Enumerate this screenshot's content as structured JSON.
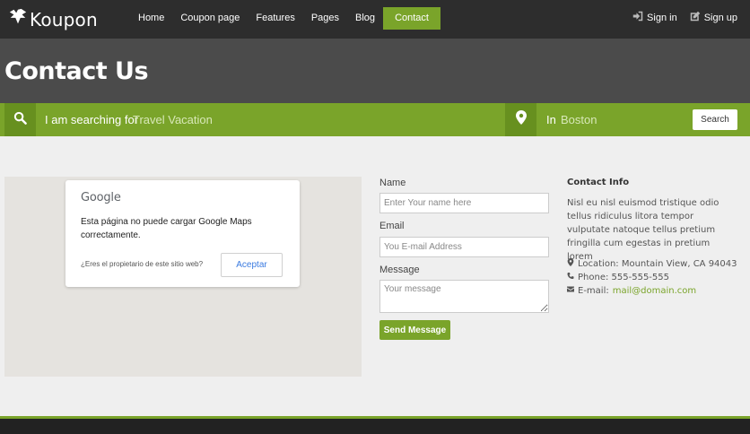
{
  "brand": {
    "name": "Koupon"
  },
  "nav": {
    "items": [
      {
        "label": "Home"
      },
      {
        "label": "Coupon page"
      },
      {
        "label": "Features"
      },
      {
        "label": "Pages"
      },
      {
        "label": "Blog"
      },
      {
        "label": "Contact",
        "active": true
      }
    ]
  },
  "auth": {
    "sign_in": "Sign in",
    "sign_up": "Sign up"
  },
  "page": {
    "title": "Contact Us"
  },
  "search": {
    "label": "I am searching for",
    "placeholder": "Travel Vacation",
    "location_label": "In",
    "location_placeholder": "Boston",
    "button": "Search"
  },
  "map": {
    "logo": "Google",
    "message": "Esta página no puede cargar Google Maps correctamente.",
    "owner_question": "¿Eres el propietario de este sitio web?",
    "accept": "Aceptar"
  },
  "form": {
    "name_label": "Name",
    "name_placeholder": "Enter Your name here",
    "email_label": "Email",
    "email_placeholder": "You E-mail Address",
    "message_label": "Message",
    "message_placeholder": "Your message",
    "submit": "Send Message"
  },
  "contact_info": {
    "title": "Contact Info",
    "text": "Nisl eu nisl euismod tristique odio tellus ridiculus litora tempor vulputate natoque tellus pretium fringilla cum egestas in pretium lorem",
    "location": "Location: Mountain View, CA 94043",
    "phone": "Phone: 555-555-555",
    "email_label": "E-mail:",
    "email": "mail@domain.com"
  },
  "colors": {
    "accent": "#7aa42a",
    "navbar": "#2d2d2d",
    "title_band": "#4b4b4b",
    "background": "#efefef"
  }
}
